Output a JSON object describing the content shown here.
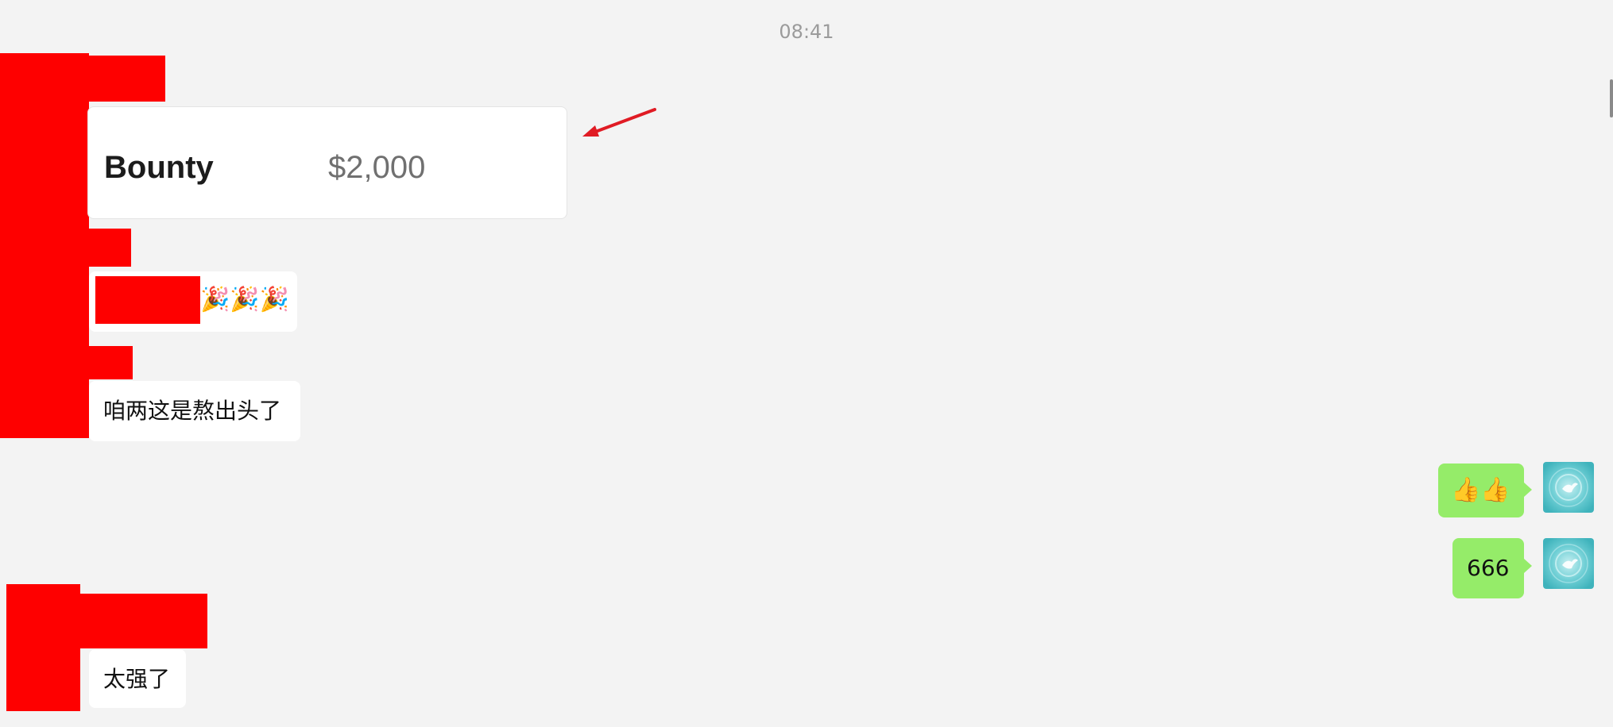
{
  "timestamp": "08:41",
  "bounty_card": {
    "label": "Bounty",
    "value": "$2,000"
  },
  "messages": {
    "emoji_row": "🎉🎉🎉",
    "chinese_1": "咱两这是熬出头了",
    "thumbs": "👍👍",
    "self_666": "666",
    "chinese_2": "太强了"
  },
  "colors": {
    "background": "#f3f3f3",
    "self_bubble": "#95ec69",
    "redaction": "#fe0000",
    "annotation_arrow": "#e01b24"
  },
  "icons": {
    "avatar": "teal-water-bird-avatar",
    "arrow": "annotation-arrow-icon"
  }
}
